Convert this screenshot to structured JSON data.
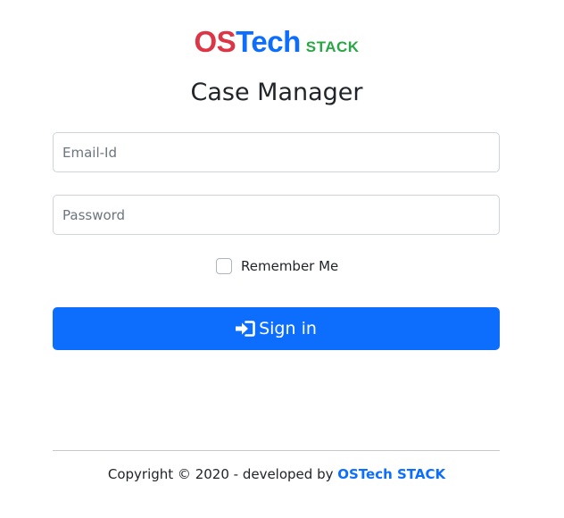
{
  "logo": {
    "part_os": "OS",
    "part_tech": "Tech",
    "part_stack": "STACK",
    "colors": {
      "os": "#dc3545",
      "tech": "#0d6efd",
      "stack": "#28a745"
    }
  },
  "title": "Case Manager",
  "form": {
    "email_placeholder": "Email-Id",
    "email_value": "",
    "password_placeholder": "Password",
    "password_value": "",
    "remember_label": "Remember Me",
    "remember_checked": false,
    "signin_label": "Sign in",
    "signin_icon": "sign-in-icon",
    "accent_color": "#0d6efd"
  },
  "footer": {
    "text": "Copyright © 2020 - developed by ",
    "link_text": "OSTech STACK"
  }
}
